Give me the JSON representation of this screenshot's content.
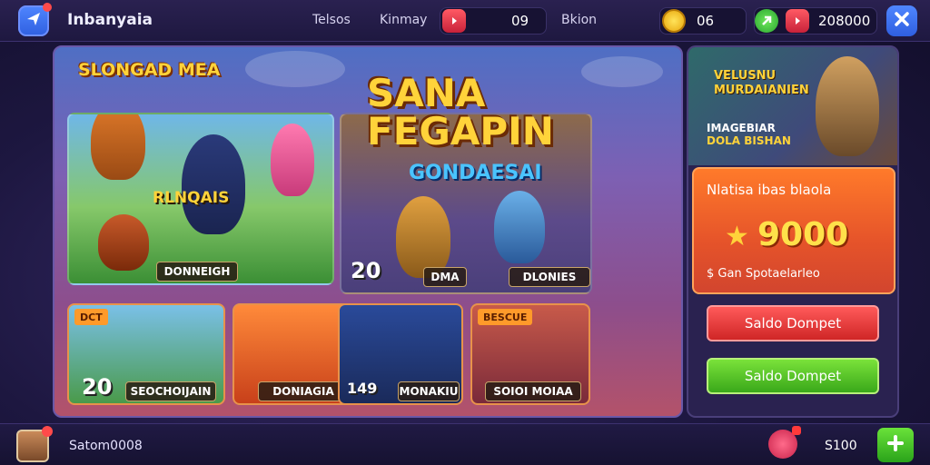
{
  "header": {
    "app_title": "Inbanyaia",
    "nav": [
      "Telsos",
      "Kinmay"
    ],
    "ticket_value": "09",
    "region_label": "Bkion",
    "coins": "06",
    "gems": "208000"
  },
  "main": {
    "section_title": "SLONGAD MEA",
    "hero_card": {
      "overlay": "RLNQAIS",
      "label": "DONNEIGH"
    },
    "feature_card": {
      "title_line1": "SANA",
      "title_line2": "FEGAPIN",
      "subtitle": "GONDAESAI",
      "badge": "20",
      "label1": "DMA",
      "label2": "DLONIES"
    },
    "mini_cards": [
      {
        "tag": "DCT",
        "badge": "20",
        "label": "SEOCHOIJAIN"
      },
      {
        "tag": "",
        "badge": "",
        "label": "DONIAGIA"
      },
      {
        "tag": "",
        "badge": "149",
        "label": "MONAKIU"
      },
      {
        "tag": "BESCUE",
        "badge": "",
        "label": "SOIOI MOIAA"
      }
    ]
  },
  "right_panel": {
    "promo_title_line1": "VELUSNU",
    "promo_title_line2": "MURDAIANIEN",
    "promo_sub_line1": "IMAGEBIAR",
    "promo_sub_line2": "DOLA BISHAN",
    "reward_title": "Nlatisa ibas blaola",
    "reward_value": "9000",
    "reward_caption": "$ Gan Spotaelarleo",
    "btn_primary": "Saldo Dompet",
    "btn_secondary": "Saldo Dompet"
  },
  "footer": {
    "balance_label": "Satom0008",
    "amount": "S100"
  }
}
